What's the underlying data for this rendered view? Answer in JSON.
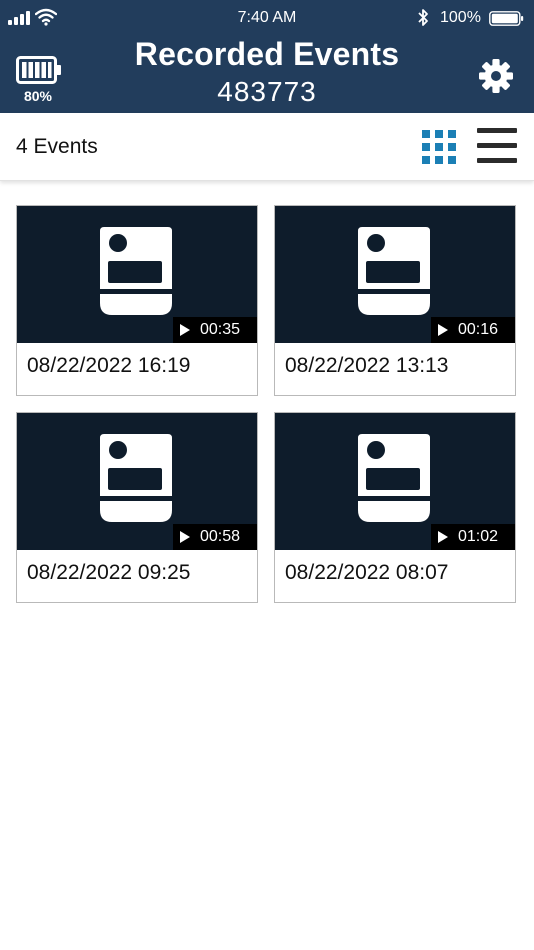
{
  "status_bar": {
    "time": "7:40 AM",
    "battery_percent": "100%"
  },
  "header": {
    "title": "Recorded Events",
    "device_id": "483773",
    "device_battery": "80%"
  },
  "toolbar": {
    "event_count": "4 Events",
    "active_view": "grid"
  },
  "colors": {
    "header_bg": "#223d5c",
    "thumbnail_bg": "#0e1c2b",
    "grid_icon": "#1b7fb5"
  },
  "icons": {
    "settings": "gear-icon",
    "grid_view": "grid-view-icon",
    "list_view": "list-view-icon",
    "camera": "body-camera-icon",
    "play": "play-icon"
  },
  "events": [
    {
      "duration": "00:35",
      "date": "08/22/2022 16:19"
    },
    {
      "duration": "00:16",
      "date": "08/22/2022 13:13"
    },
    {
      "duration": "00:58",
      "date": "08/22/2022 09:25"
    },
    {
      "duration": "01:02",
      "date": "08/22/2022 08:07"
    }
  ]
}
